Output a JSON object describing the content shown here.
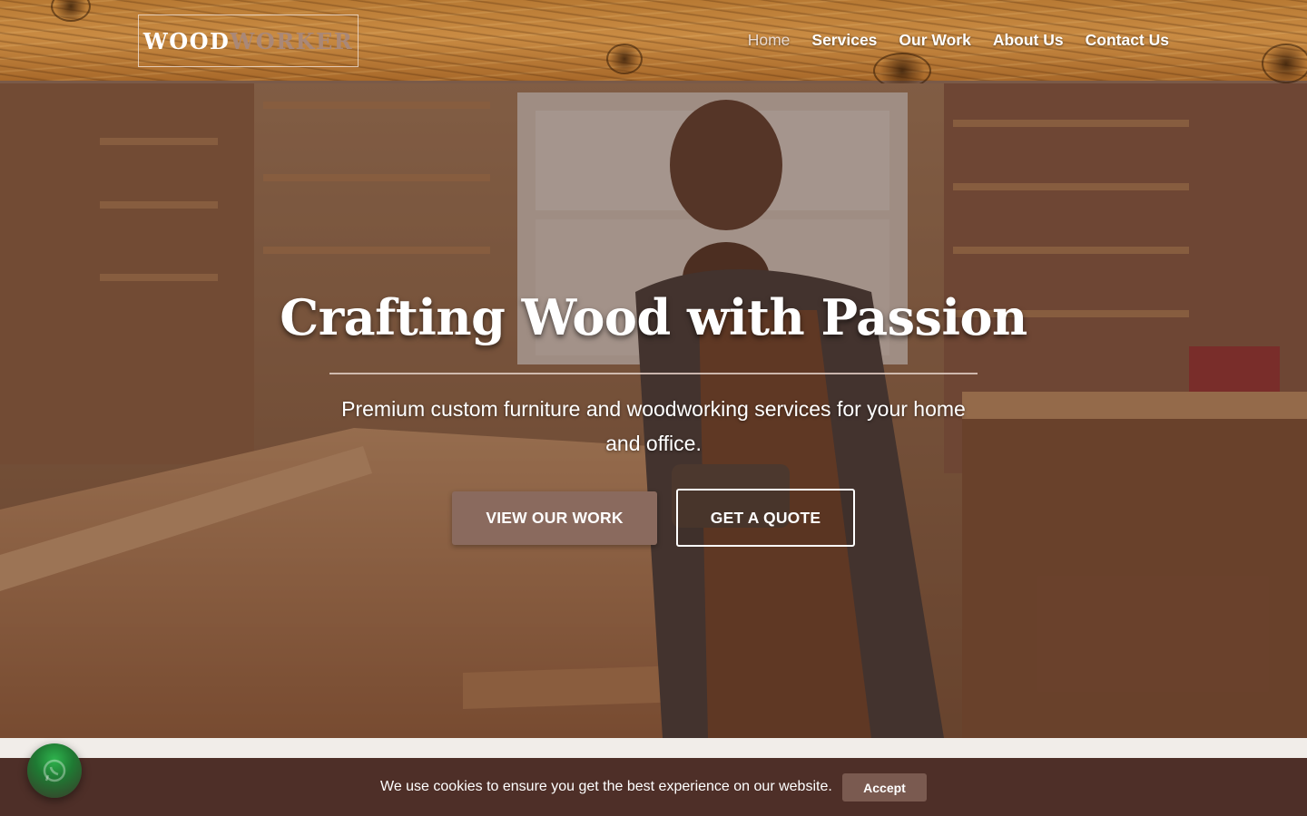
{
  "brand": {
    "logo_part1": "WOOD",
    "logo_part2": "WORKER"
  },
  "nav": {
    "items": [
      {
        "label": "Home",
        "active": true
      },
      {
        "label": "Services"
      },
      {
        "label": "Our Work"
      },
      {
        "label": "About Us"
      },
      {
        "label": "Contact Us"
      }
    ]
  },
  "hero": {
    "title": "Crafting Wood with Passion",
    "subtitle": "Premium custom furniture and woodworking services for your home and office.",
    "primary_button": "VIEW OUR WORK",
    "secondary_button": "GET A QUOTE"
  },
  "cookie_banner": {
    "message": "We use cookies to ensure you get the best experience on our website.",
    "accept_label": "Accept"
  },
  "floating": {
    "icon": "whatsapp-icon"
  },
  "colors": {
    "header_wood": "#c98b43",
    "primary_button": "#8a6a5e",
    "cookie_bar": "#4e2f28",
    "whatsapp": "#25d366"
  }
}
